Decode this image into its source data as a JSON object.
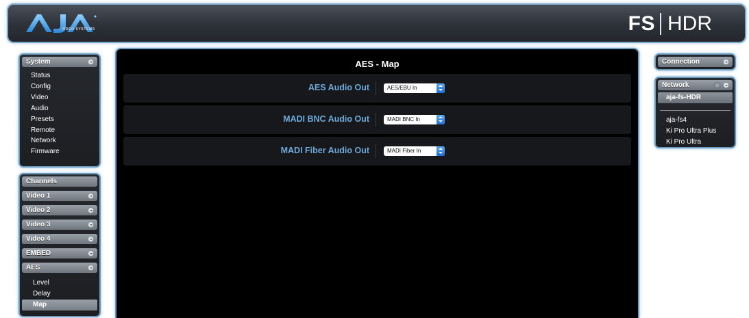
{
  "header": {
    "logo_text": "AJA",
    "logo_subtitle": "VIDEO SYSTEMS",
    "product_fs": "FS",
    "product_hdr": "HDR"
  },
  "system_panel": {
    "title": "System",
    "items": [
      {
        "label": "Status"
      },
      {
        "label": "Config"
      },
      {
        "label": "Video"
      },
      {
        "label": "Audio"
      },
      {
        "label": "Presets"
      },
      {
        "label": "Remote"
      },
      {
        "label": "Network"
      },
      {
        "label": "Firmware"
      }
    ]
  },
  "channels_panel": {
    "title": "Channels",
    "groups": [
      {
        "label": "Video 1"
      },
      {
        "label": "Video 2"
      },
      {
        "label": "Video 3"
      },
      {
        "label": "Video 4"
      },
      {
        "label": "EMBED"
      },
      {
        "label": "AES"
      }
    ],
    "aes_items": [
      {
        "label": "Level"
      },
      {
        "label": "Delay"
      },
      {
        "label": "Map"
      }
    ],
    "active_item": "Map"
  },
  "main": {
    "title": "AES - Map",
    "rows": [
      {
        "label": "AES Audio Out",
        "value": "AES/EBU In"
      },
      {
        "label": "MADI BNC Audio Out",
        "value": "MADI BNC In"
      },
      {
        "label": "MADI Fiber Audio Out",
        "value": "MADI Fiber In"
      }
    ]
  },
  "connection_panel": {
    "title": "Connection"
  },
  "network_panel": {
    "title": "Network",
    "selected": "aja-fs-HDR",
    "devices": [
      {
        "label": "aja-fs4"
      },
      {
        "label": "Ki Pro Ultra Plus"
      },
      {
        "label": "Ki Pro Ultra"
      }
    ]
  },
  "colors": {
    "accent_blue": "#6fa9d7",
    "panel_border": "#6d9bbf",
    "select_arrow": "#1e6ed6"
  }
}
